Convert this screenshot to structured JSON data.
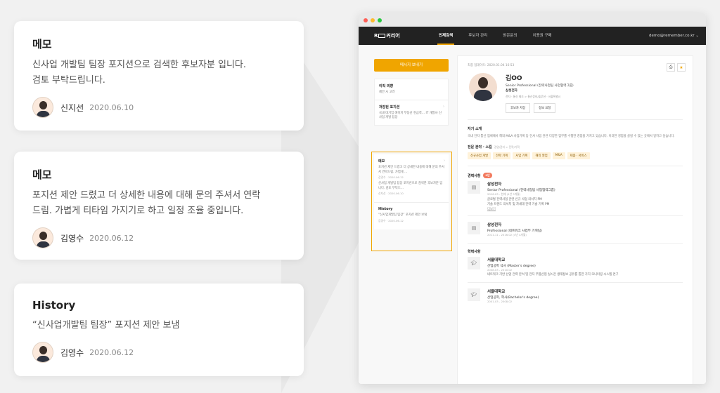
{
  "cards": [
    {
      "title": "메모",
      "text_lines": [
        "신사업 개발팀 팀장 포지션으로 검색한 후보자분 입니다.",
        "검토 부탁드립니다."
      ],
      "author": "신지선",
      "date": "2020.06.10"
    },
    {
      "title": "메모",
      "text_lines": [
        "포지션 제안 드렸고 더 상세한 내용에 대해 문의 주셔서 연락",
        "드림. 가볍게 티타임 가지기로 하고 일정 조율 중입니다."
      ],
      "author": "김영수",
      "date": "2020.06.12"
    },
    {
      "title": "History",
      "text_lines": [
        "“신사업개발팀 팀장” 포지션 제안 보냄"
      ],
      "author": "김영수",
      "date": "2020.06.12"
    }
  ],
  "nav": {
    "logo_left": "R",
    "logo_right": "커리어",
    "tabs": [
      "인재검색",
      "후보자 관리",
      "받은문의",
      "이용권 구매"
    ],
    "active_tab": "인재검색",
    "account": "demo@remember.co.kr"
  },
  "sidebar": {
    "message_button": "메시지 보내기",
    "intent": {
      "title": "이직 의향",
      "text": "제안 시 고려"
    },
    "saved": {
      "title": "저장된 포지션",
      "text": "국내 대기업 에이치 부동산 현금착… IT 개발사 신사업 개발 팀장"
    },
    "memo": {
      "title": "메모",
      "items": [
        {
          "text": "포지션 제안 드렸고 더 상세한 내용에 대해 문의 주셔서 연락드림. 가볍게 …",
          "meta": "김영수 · 2020.06.12"
        },
        {
          "text": "신사업 개발팀 팀장 포지션으로 검색한 후보자분 입니다. 검토 부탁드…",
          "meta": "신지선 · 2020.06.10"
        }
      ]
    },
    "history": {
      "title": "History",
      "text": "“신사업개발팀 팀장” 포지션 제안 보냄",
      "meta": "김영수 · 2020.06.12"
    }
  },
  "profile": {
    "updated": "최종 업데이트: 2020.01.04 16:53",
    "name": "김OO",
    "title": "Senior Professional (전략사업팀 사업협력그룹)",
    "company": "삼성전자",
    "tags": "전자 · 통신 제조 > 통신장비/솔루션 · 서울특별시",
    "btn_save": "후보자 저장",
    "btn_request": "정보 요청"
  },
  "intro": {
    "title": "자기 소개",
    "text": "국내 전자 통신 업체에서 해외 M&A 사업기획 등 전사 사업 관련 다양한 업무를 수행한 경험을 가지고 있습니다. 이러한 경험을 살릴 수 있는 곳에서 일하고 싶습니다."
  },
  "skills": {
    "title": "전문 분야 · 스킬",
    "subtitle": "경영/관리 > 전략/기획",
    "chips": [
      "신규사업 개발",
      "전략 기획",
      "사업 기획",
      "해외 영업",
      "M&A",
      "제품 · 서비스"
    ]
  },
  "career": {
    "title": "경력사항",
    "badge": "9년",
    "entries": [
      {
        "company": "삼성전자",
        "role": "Senior Professional (전략사업팀 사업협력그룹)",
        "period": "2016.03 - 현재 (4년 3개월)",
        "desc": [
          "글로벌 전략사업 관련 신규 사업 리서치 PM",
          "기술 트렌드 리서치 및 차세대 전략 기술 기획 PM"
        ],
        "more": "더보기"
      },
      {
        "company": "삼성전자",
        "role": "Professional (네트워크 사업부 기획팀)",
        "period": "2011.11 - 2016.02 (4년 4개월)",
        "desc": [],
        "more": ""
      }
    ]
  },
  "education": {
    "title": "학력사항",
    "entries": [
      {
        "school": "서울대학교",
        "degree": "산업공학 석사 (Master's degree)",
        "period": "2008.03 - 2010.02",
        "desc": "네트워크 기반 산업 전략 분석 및 전자 부품산업 실시간 생태정보 공유를 통한 가치 모니터링 시스템 연구"
      },
      {
        "school": "서울대학교",
        "degree": "산업공학, 학사(Bachelor's degree)",
        "period": "2001.03 - 2008.02",
        "desc": ""
      }
    ]
  },
  "colors": {
    "accent": "#f0a500",
    "navbar": "#222222",
    "badge": "#f27a5e"
  },
  "icons": [
    "print-icon",
    "star-icon",
    "briefcase-icon",
    "graduation-cap-icon",
    "chevron-down-icon"
  ]
}
